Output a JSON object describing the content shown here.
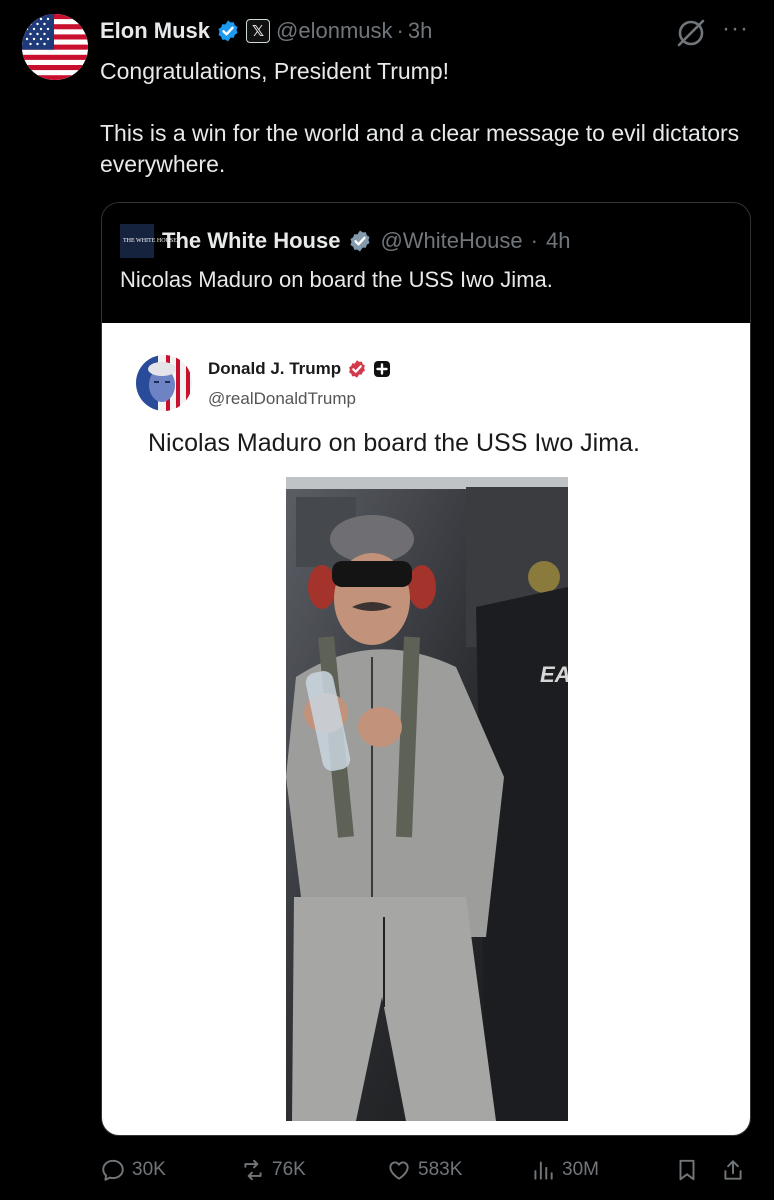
{
  "author": {
    "name": "Elon Musk",
    "affiliate_badge": "𝕏",
    "handle": "@elonmusk",
    "separator": "·",
    "time": "3h"
  },
  "tweet": {
    "text": "Congratulations, President Trump!\n\nThis is a win for the world and a clear message to evil dictators everywhere."
  },
  "quote": {
    "name": "The White House",
    "logo_text": "THE WHITE HOUSE",
    "handle": "@WhiteHouse",
    "separator": "·",
    "time": "4h",
    "text": "Nicolas Maduro on board the USS Iwo Jima.",
    "embedded": {
      "name": "Donald J. Trump",
      "handle": "@realDonaldTrump",
      "text": "Nicolas Maduro on board the USS Iwo Jima.",
      "photo_text": "EA"
    }
  },
  "actions": {
    "replies": "30K",
    "reposts": "76K",
    "likes": "583K",
    "views": "30M"
  },
  "icons": {
    "verified": "verified-badge-icon",
    "grok": "grok-icon",
    "more": "more-icon",
    "reply": "reply-icon",
    "repost": "repost-icon",
    "like": "like-icon",
    "views": "views-icon",
    "bookmark": "bookmark-icon",
    "share": "share-icon"
  },
  "colors": {
    "background": "#000000",
    "verified_blue": "#1d9bf0",
    "trump_badge": "#d23a4a",
    "muted": "#71767b"
  }
}
